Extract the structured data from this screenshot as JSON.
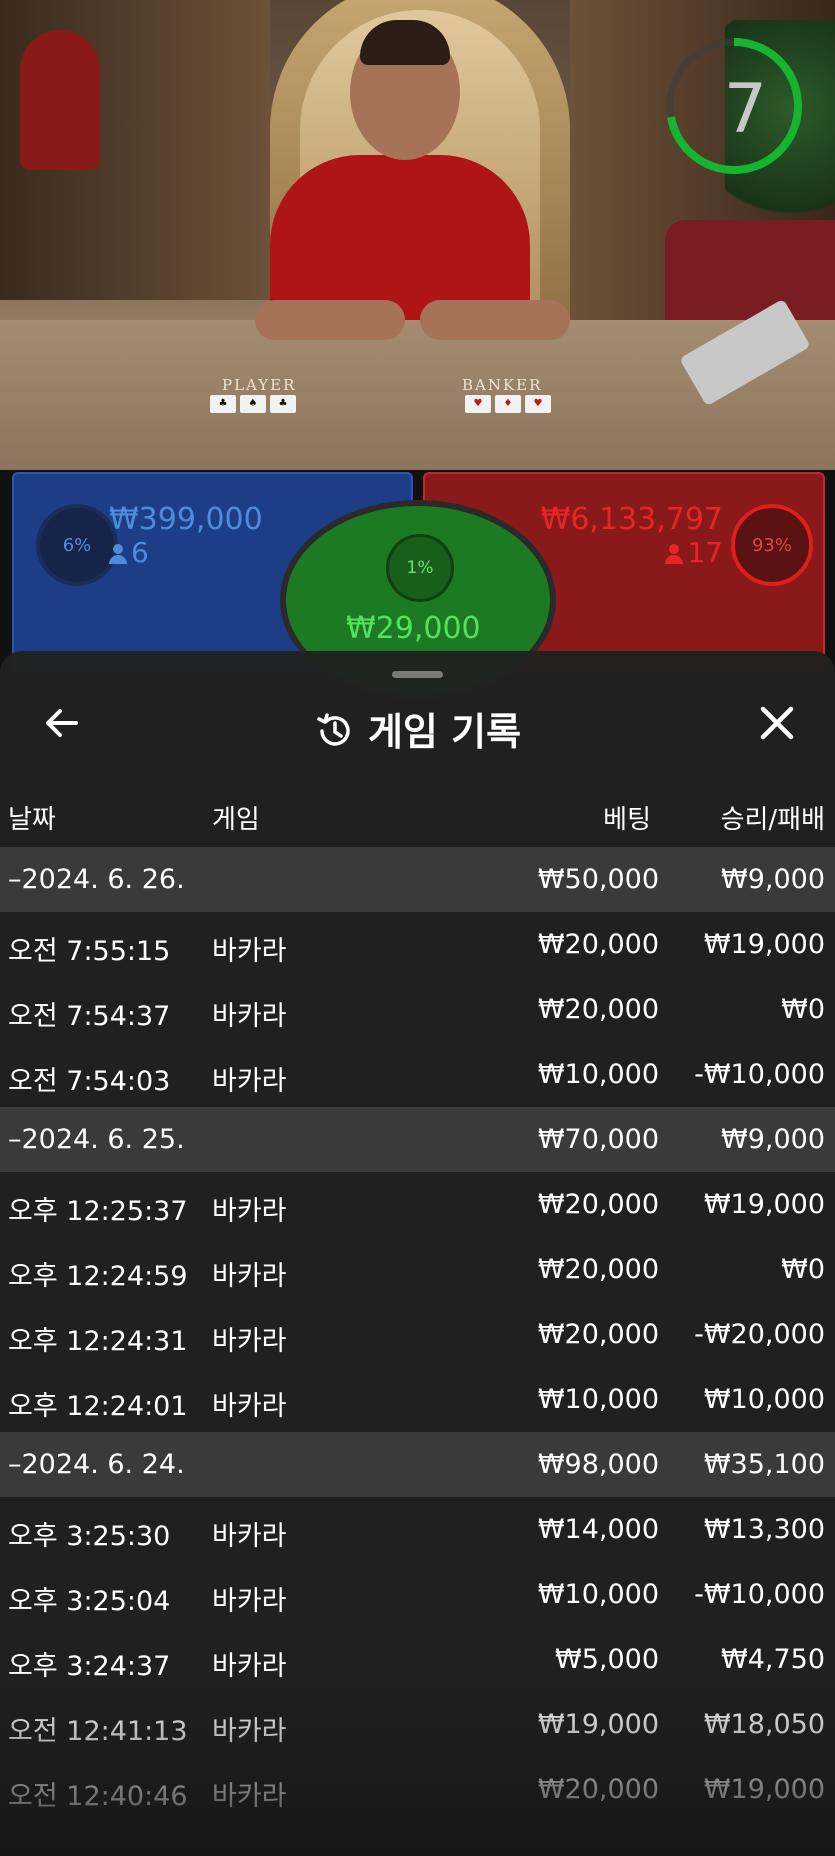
{
  "video": {
    "timer": "7",
    "timer_color": "#16b52f",
    "labels": {
      "player": "PLAYER",
      "banker": "BANKER"
    }
  },
  "bets": {
    "player": {
      "percent": "6%",
      "amount": "₩399,000",
      "count": "6",
      "color": "#4f8bdc"
    },
    "tie": {
      "percent": "1%",
      "amount": "₩29,000",
      "color": "#55e060"
    },
    "banker": {
      "percent": "93%",
      "amount": "₩6,133,797",
      "count": "17",
      "color": "#e62626"
    }
  },
  "sheet": {
    "title": "게임 기록",
    "icons": {
      "back": "arrow-left-icon",
      "history": "history-icon",
      "close": "close-icon"
    },
    "columns": {
      "date": "날짜",
      "game": "게임",
      "bet": "베팅",
      "win_loss": "승리/패배"
    },
    "rows": [
      {
        "type": "group",
        "date": "–2024. 6. 26.",
        "game": "",
        "bet": "₩50,000",
        "win_loss": "₩9,000"
      },
      {
        "type": "item",
        "date": "오전 7:55:15",
        "game": "바카라",
        "bet": "₩20,000",
        "win_loss": "₩19,000"
      },
      {
        "type": "item",
        "date": "오전 7:54:37",
        "game": "바카라",
        "bet": "₩20,000",
        "win_loss": "₩0"
      },
      {
        "type": "item",
        "date": "오전 7:54:03",
        "game": "바카라",
        "bet": "₩10,000",
        "win_loss": "-₩10,000"
      },
      {
        "type": "group",
        "date": "–2024. 6. 25.",
        "game": "",
        "bet": "₩70,000",
        "win_loss": "₩9,000"
      },
      {
        "type": "item",
        "date": "오후 12:25:37",
        "game": "바카라",
        "bet": "₩20,000",
        "win_loss": "₩19,000"
      },
      {
        "type": "item",
        "date": "오후 12:24:59",
        "game": "바카라",
        "bet": "₩20,000",
        "win_loss": "₩0"
      },
      {
        "type": "item",
        "date": "오후 12:24:31",
        "game": "바카라",
        "bet": "₩20,000",
        "win_loss": "-₩20,000"
      },
      {
        "type": "item",
        "date": "오후 12:24:01",
        "game": "바카라",
        "bet": "₩10,000",
        "win_loss": "₩10,000"
      },
      {
        "type": "group",
        "date": "–2024. 6. 24.",
        "game": "",
        "bet": "₩98,000",
        "win_loss": "₩35,100"
      },
      {
        "type": "item",
        "date": "오후 3:25:30",
        "game": "바카라",
        "bet": "₩14,000",
        "win_loss": "₩13,300"
      },
      {
        "type": "item",
        "date": "오후 3:25:04",
        "game": "바카라",
        "bet": "₩10,000",
        "win_loss": "-₩10,000"
      },
      {
        "type": "item",
        "date": "오후 3:24:37",
        "game": "바카라",
        "bet": "₩5,000",
        "win_loss": "₩4,750"
      },
      {
        "type": "item",
        "date": "오전 12:41:13",
        "game": "바카라",
        "bet": "₩19,000",
        "win_loss": "₩18,050"
      },
      {
        "type": "item",
        "date": "오전 12:40:46",
        "game": "바카라",
        "bet": "₩20,000",
        "win_loss": "₩19,000"
      }
    ]
  }
}
